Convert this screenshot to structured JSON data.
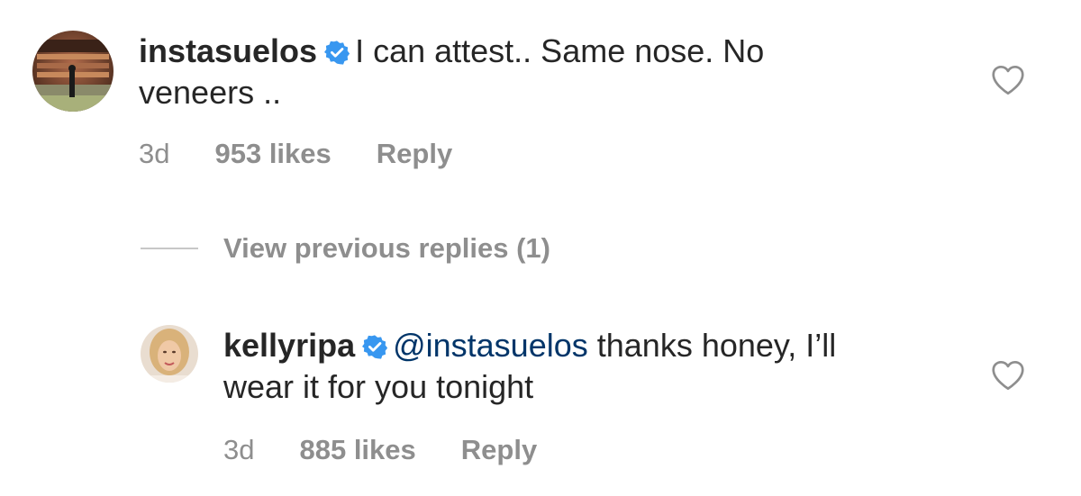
{
  "comment1": {
    "username": "instasuelos",
    "text_line1": "I can attest.. Same nose. No",
    "text_line2": "veneers ..",
    "time": "3d",
    "likes": "953 likes",
    "reply": "Reply"
  },
  "view_replies": {
    "label": "View previous replies (1)"
  },
  "comment2": {
    "username": "kellyripa",
    "mention": "@instasuelos",
    "text_line1_rest": "thanks honey, I’ll",
    "text_line2": "wear it for you tonight",
    "time": "3d",
    "likes": "885 likes",
    "reply": "Reply"
  },
  "icons": {
    "verified": "verified-badge-icon",
    "like": "heart-outline-icon"
  },
  "colors": {
    "verified_blue": "#3897f0",
    "mention": "#003569",
    "meta_gray": "#8e8e8e"
  }
}
